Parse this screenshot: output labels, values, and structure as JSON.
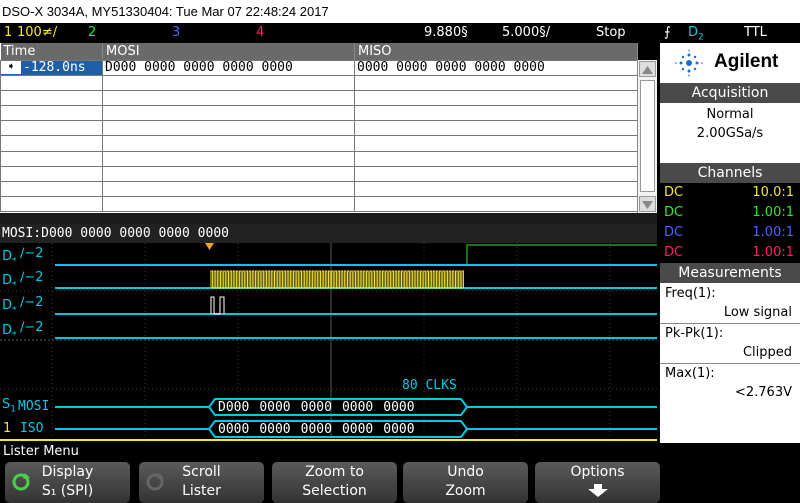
{
  "title": "DSO-X 3034A, MY51330404: Tue Mar 07 22:48:24 2017",
  "status": {
    "ch1_label": "1",
    "ch1_scale": "100≠/",
    "ch2_label": "2",
    "ch3_label": "3",
    "ch4_label": "4",
    "time_offset": "9.880§",
    "time_scale": "5.000§/",
    "run_state": "Stop",
    "trigger_icon": "trigger-edge-icon",
    "trigger_source": "D",
    "trigger_source_sub": "2",
    "trigger_type": "TTL"
  },
  "lister": {
    "columns": [
      "Time",
      "MOSI",
      "MISO"
    ],
    "rows": [
      {
        "time": "-128.0ns",
        "mosi": "D000  0000  0000  0000  0000",
        "miso": "0000  0000  0000  0000  0000"
      },
      {
        "time": "",
        "mosi": "",
        "miso": ""
      },
      {
        "time": "",
        "mosi": "",
        "miso": ""
      },
      {
        "time": "",
        "mosi": "",
        "miso": ""
      },
      {
        "time": "",
        "mosi": "",
        "miso": ""
      },
      {
        "time": "",
        "mosi": "",
        "miso": ""
      },
      {
        "time": "",
        "mosi": "",
        "miso": ""
      },
      {
        "time": "",
        "mosi": "",
        "miso": ""
      },
      {
        "time": "",
        "mosi": "",
        "miso": ""
      },
      {
        "time": "",
        "mosi": "",
        "miso": ""
      }
    ]
  },
  "decode_summary": "MOSI:D000  0000  0000  0000  0000",
  "waveform": {
    "digital_channels": [
      {
        "label": "D",
        "sub": "*",
        "marker": "2"
      },
      {
        "label": "D",
        "sub": "*",
        "marker": "2"
      },
      {
        "label": "D",
        "sub": "*",
        "marker": "2"
      },
      {
        "label": "D",
        "sub": "*",
        "marker": "2"
      }
    ],
    "clk_count": "80 CLKS",
    "bus_label_1": "S",
    "bus_label_1_sub": "1",
    "mosi_label": "MOSI",
    "miso_label": "ISO",
    "mosi_words": [
      "D000",
      "0000",
      "0000",
      "0000",
      "0000"
    ],
    "miso_words": [
      "0000",
      "0000",
      "0000",
      "0000",
      "0000"
    ],
    "ch1_marker": "1"
  },
  "panel": {
    "brand": "Agilent",
    "acquisition_header": "Acquisition",
    "acq_mode": "Normal",
    "acq_rate": "2.00GSa/s",
    "channels_header": "Channels",
    "channels": [
      {
        "coupling": "DC",
        "probe": "10.0:1",
        "color": "#f5e633"
      },
      {
        "coupling": "DC",
        "probe": "1.00:1",
        "color": "#33e633"
      },
      {
        "coupling": "DC",
        "probe": "1.00:1",
        "color": "#4a63ff"
      },
      {
        "coupling": "DC",
        "probe": "1.00:1",
        "color": "#ff1f6b"
      }
    ],
    "measurements_header": "Measurements",
    "meas": [
      {
        "name": "Freq(1):",
        "value": "Low signal"
      },
      {
        "name": "Pk-Pk(1):",
        "value": "Clipped"
      },
      {
        "name": "Max(1):",
        "value": "<2.763V"
      }
    ]
  },
  "menu_label": "Lister Menu",
  "softkeys": [
    {
      "line1": "Display",
      "line2": "S₁ (SPI)",
      "icon": "rotate-knob-icon"
    },
    {
      "line1": "Scroll",
      "line2": "Lister",
      "icon": "rotate-knob-icon"
    },
    {
      "line1": "Zoom to",
      "line2": "Selection"
    },
    {
      "line1": "Undo",
      "line2": "Zoom"
    },
    {
      "line1": "Options",
      "line2": "",
      "icon": "down-arrow-icon"
    }
  ],
  "colors": {
    "ch1": "#f5e633",
    "ch2": "#33e633",
    "ch3": "#4a63ff",
    "ch4": "#ff1f6b",
    "digital": "#00c8e6",
    "selection": "#1f5fa8"
  }
}
